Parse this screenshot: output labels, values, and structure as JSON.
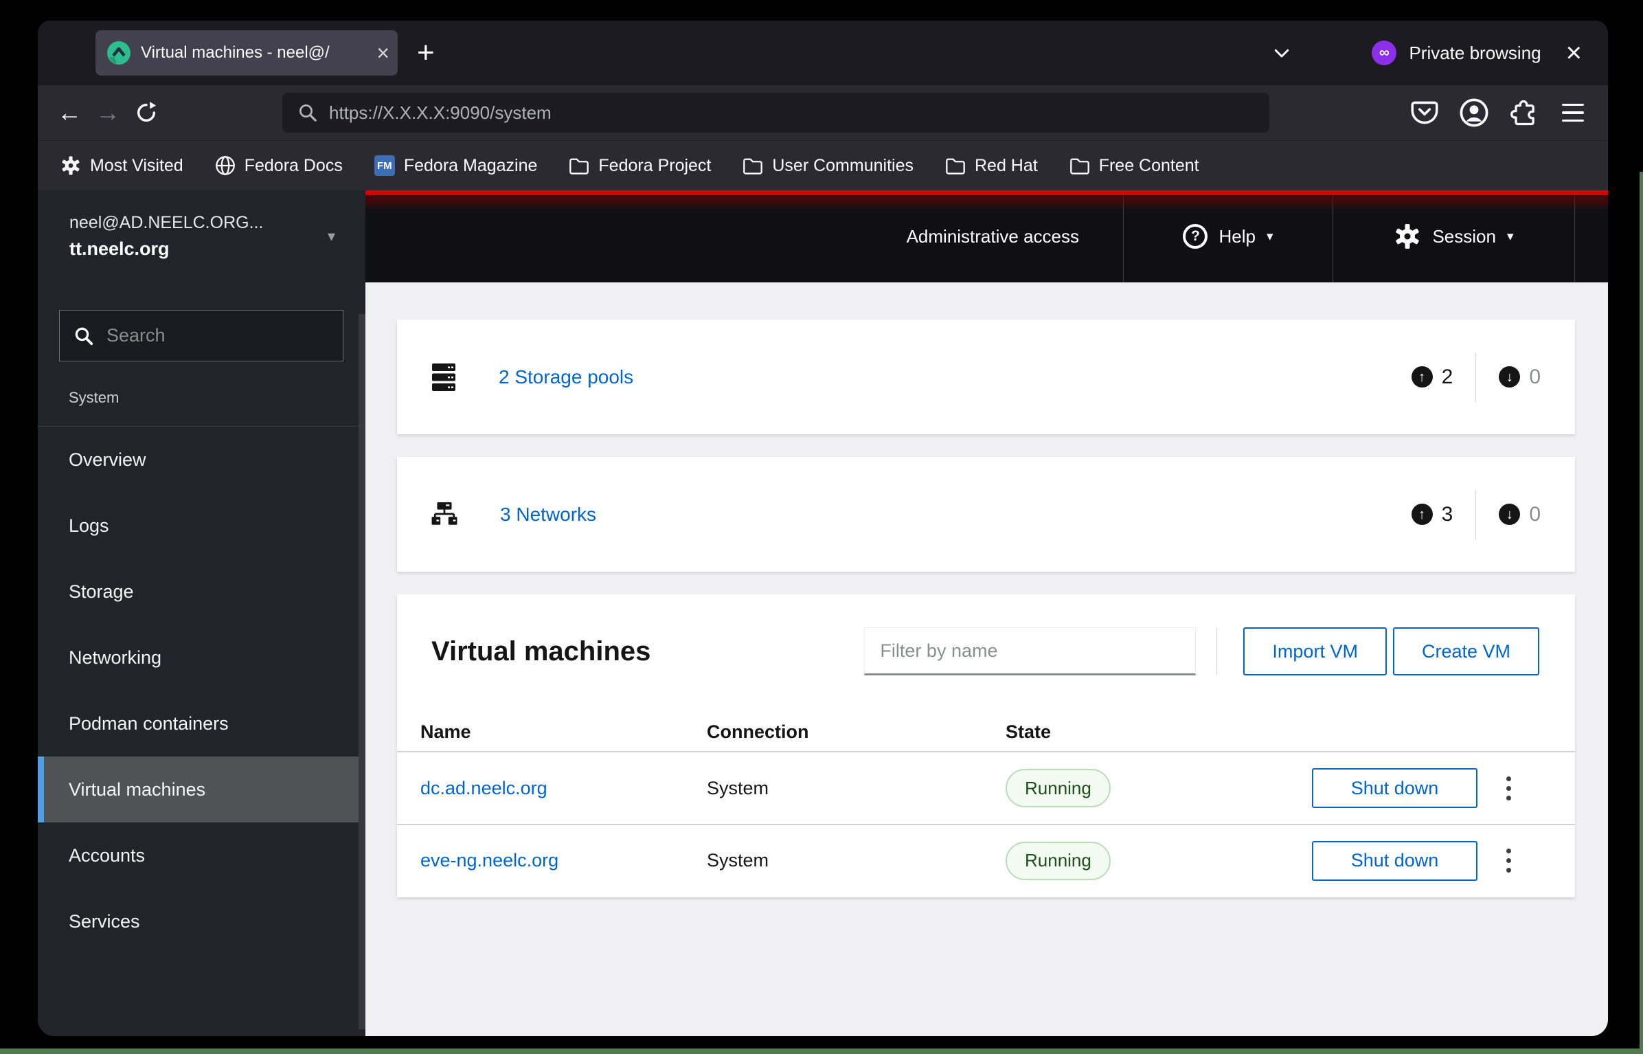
{
  "glyphs": {
    "plus": "+",
    "close_x": "×",
    "back_arrow": "←",
    "forward_arrow": "→",
    "caret_down": "▾",
    "mask_infinity": "∞",
    "question_mark": "?",
    "up_arrow": "↑",
    "down_arrow": "↓"
  },
  "browser": {
    "tab": {
      "title": "Virtual machines - neel@/"
    },
    "private_label": "Private browsing",
    "urlbar": {
      "url": "https://X.X.X.X:9090/system"
    },
    "bookmarks": [
      {
        "label": "Most Visited"
      },
      {
        "label": "Fedora Docs"
      },
      {
        "label": "Fedora Magazine",
        "badge": "FM"
      },
      {
        "label": "Fedora Project"
      },
      {
        "label": "User Communities"
      },
      {
        "label": "Red Hat"
      },
      {
        "label": "Free Content"
      }
    ]
  },
  "app": {
    "colors": {
      "accent_blue": "#0066cc",
      "alert_red_line": "#d60000",
      "nav_selected_border": "#4da0e5",
      "running_text_green": "#1e4f18",
      "running_bg_green": "#f3faf2"
    },
    "sidebar": {
      "account": {
        "user": "neel@AD.NEELC.ORG...",
        "host": "tt.neelc.org"
      },
      "search_placeholder": "Search",
      "section_label": "System",
      "items": [
        {
          "label": "Overview"
        },
        {
          "label": "Logs"
        },
        {
          "label": "Storage"
        },
        {
          "label": "Networking"
        },
        {
          "label": "Podman containers"
        },
        {
          "label": "Virtual machines"
        },
        {
          "label": "Accounts"
        },
        {
          "label": "Services"
        }
      ]
    },
    "masthead": {
      "admin_label": "Administrative access",
      "help_label": "Help",
      "session_label": "Session"
    },
    "overview_cards": [
      {
        "link": "2 Storage pools",
        "up_count": "2",
        "down_count": "0"
      },
      {
        "link": "3 Networks",
        "up_count": "3",
        "down_count": "0"
      }
    ],
    "vm_panel": {
      "title": "Virtual machines",
      "filter_placeholder": "Filter by name",
      "import_button": "Import VM",
      "create_button": "Create VM",
      "columns": [
        "Name",
        "Connection",
        "State"
      ],
      "rows": [
        {
          "name": "dc.ad.neelc.org",
          "connection": "System",
          "state": "Running",
          "action": "Shut down"
        },
        {
          "name": "eve-ng.neelc.org",
          "connection": "System",
          "state": "Running",
          "action": "Shut down"
        }
      ]
    }
  }
}
